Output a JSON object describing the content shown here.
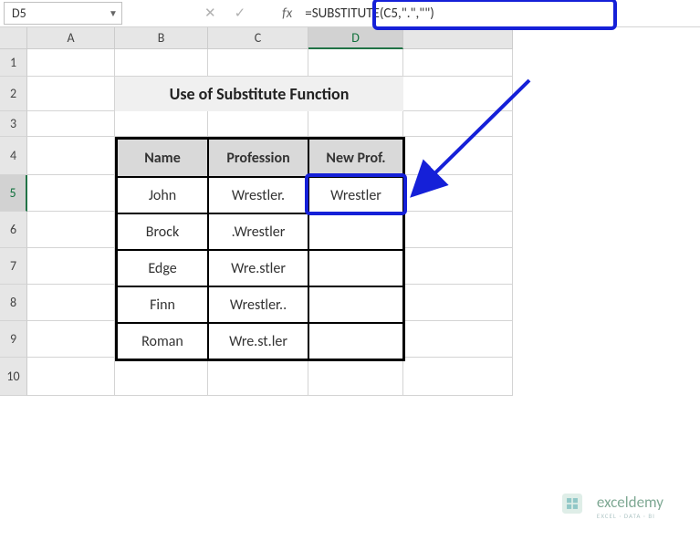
{
  "name_box": "D5",
  "formula": "=SUBSTITUTE(C5,\".\",\"\")",
  "title": "Use of Substitute Function",
  "col_headers": [
    "A",
    "B",
    "C",
    "D"
  ],
  "row_headers": [
    "1",
    "2",
    "3",
    "4",
    "5",
    "6",
    "7",
    "8",
    "9",
    "10"
  ],
  "selected_col": "D",
  "selected_row": "5",
  "table": {
    "headers": {
      "name": "Name",
      "profession": "Profession",
      "newprof": "New Prof."
    },
    "rows": [
      {
        "name": "John",
        "profession": "Wrestler.",
        "newprof": "Wrestler"
      },
      {
        "name": "Brock",
        "profession": ".Wrestler",
        "newprof": ""
      },
      {
        "name": "Edge",
        "profession": "Wre.stler",
        "newprof": ""
      },
      {
        "name": "Finn",
        "profession": "Wrestler..",
        "newprof": ""
      },
      {
        "name": "Roman",
        "profession": "Wre.st.ler",
        "newprof": ""
      }
    ]
  },
  "watermark": {
    "brand": "exceldemy",
    "tagline": "EXCEL · DATA · BI"
  }
}
